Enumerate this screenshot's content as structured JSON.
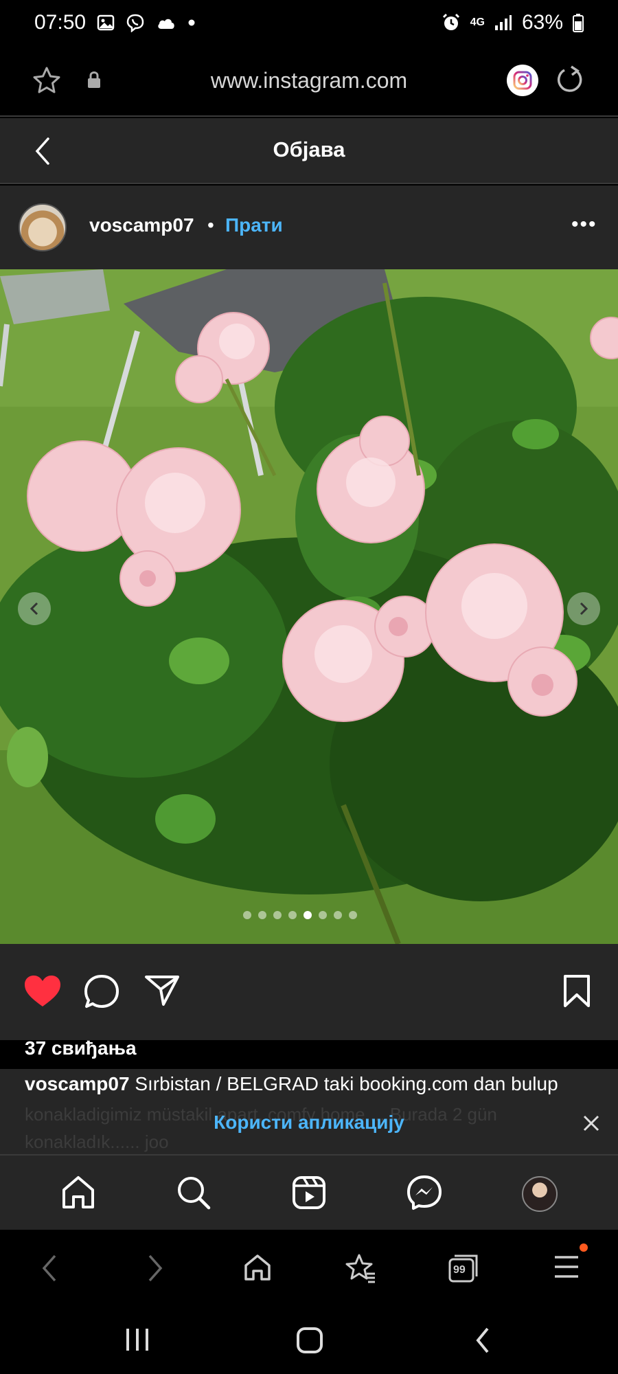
{
  "status_bar": {
    "time": "07:50",
    "network": "4G",
    "battery": "63%",
    "icons": [
      "gallery-icon",
      "viber-icon",
      "cloud-icon",
      "dot-icon",
      "alarm-icon",
      "signal-icon",
      "battery-icon"
    ]
  },
  "browser": {
    "url": "www.instagram.com",
    "icons": [
      "star-icon",
      "lock-icon",
      "instagram-icon",
      "reload-icon"
    ]
  },
  "post_header": {
    "title": "Објава"
  },
  "author": {
    "username": "voscamp07",
    "separator": "•",
    "follow_label": "Прати",
    "more_label": "•••"
  },
  "carousel": {
    "dot_count": 8,
    "active_index": 4
  },
  "actions": {
    "liked": true,
    "like_color": "#ff3040",
    "likes_text": "37 свиђања"
  },
  "caption": {
    "username": "voscamp07",
    "text": "Sırbistan / BELGRAD taki booking.com dan bulup",
    "faded_text": "konakladigimiz müstakil apart, comfy home ... Burada 2 gün konakladık...... ",
    "faded_more": "joo",
    "use_app_label": "Користи апликацију"
  },
  "instagram_nav": {
    "items": [
      "home-icon",
      "search-icon",
      "reels-icon",
      "messenger-icon",
      "profile-avatar"
    ]
  },
  "browser_nav": {
    "tabs_count": "99",
    "items": [
      "back-icon",
      "forward-icon",
      "home-icon",
      "bookmarks-icon",
      "tabs-icon",
      "menu-icon"
    ]
  },
  "colors": {
    "accent": "#4cb5f9",
    "panel": "#262626",
    "notification": "#ff5a1f"
  }
}
